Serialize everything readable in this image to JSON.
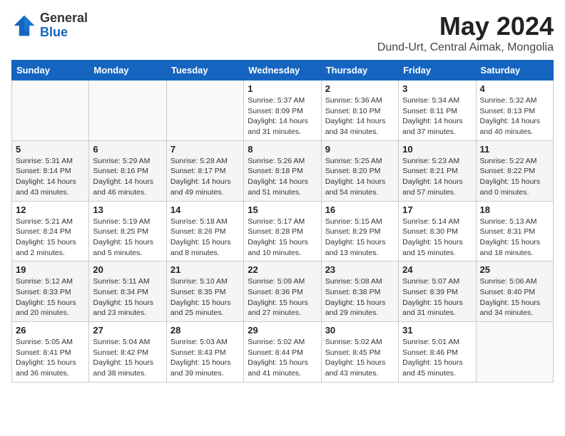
{
  "logo": {
    "general": "General",
    "blue": "Blue"
  },
  "title": "May 2024",
  "subtitle": "Dund-Urt, Central Aimak, Mongolia",
  "days_of_week": [
    "Sunday",
    "Monday",
    "Tuesday",
    "Wednesday",
    "Thursday",
    "Friday",
    "Saturday"
  ],
  "weeks": [
    [
      {
        "day": "",
        "info": ""
      },
      {
        "day": "",
        "info": ""
      },
      {
        "day": "",
        "info": ""
      },
      {
        "day": "1",
        "info": "Sunrise: 5:37 AM\nSunset: 8:09 PM\nDaylight: 14 hours\nand 31 minutes."
      },
      {
        "day": "2",
        "info": "Sunrise: 5:36 AM\nSunset: 8:10 PM\nDaylight: 14 hours\nand 34 minutes."
      },
      {
        "day": "3",
        "info": "Sunrise: 5:34 AM\nSunset: 8:11 PM\nDaylight: 14 hours\nand 37 minutes."
      },
      {
        "day": "4",
        "info": "Sunrise: 5:32 AM\nSunset: 8:13 PM\nDaylight: 14 hours\nand 40 minutes."
      }
    ],
    [
      {
        "day": "5",
        "info": "Sunrise: 5:31 AM\nSunset: 8:14 PM\nDaylight: 14 hours\nand 43 minutes."
      },
      {
        "day": "6",
        "info": "Sunrise: 5:29 AM\nSunset: 8:16 PM\nDaylight: 14 hours\nand 46 minutes."
      },
      {
        "day": "7",
        "info": "Sunrise: 5:28 AM\nSunset: 8:17 PM\nDaylight: 14 hours\nand 49 minutes."
      },
      {
        "day": "8",
        "info": "Sunrise: 5:26 AM\nSunset: 8:18 PM\nDaylight: 14 hours\nand 51 minutes."
      },
      {
        "day": "9",
        "info": "Sunrise: 5:25 AM\nSunset: 8:20 PM\nDaylight: 14 hours\nand 54 minutes."
      },
      {
        "day": "10",
        "info": "Sunrise: 5:23 AM\nSunset: 8:21 PM\nDaylight: 14 hours\nand 57 minutes."
      },
      {
        "day": "11",
        "info": "Sunrise: 5:22 AM\nSunset: 8:22 PM\nDaylight: 15 hours\nand 0 minutes."
      }
    ],
    [
      {
        "day": "12",
        "info": "Sunrise: 5:21 AM\nSunset: 8:24 PM\nDaylight: 15 hours\nand 2 minutes."
      },
      {
        "day": "13",
        "info": "Sunrise: 5:19 AM\nSunset: 8:25 PM\nDaylight: 15 hours\nand 5 minutes."
      },
      {
        "day": "14",
        "info": "Sunrise: 5:18 AM\nSunset: 8:26 PM\nDaylight: 15 hours\nand 8 minutes."
      },
      {
        "day": "15",
        "info": "Sunrise: 5:17 AM\nSunset: 8:28 PM\nDaylight: 15 hours\nand 10 minutes."
      },
      {
        "day": "16",
        "info": "Sunrise: 5:15 AM\nSunset: 8:29 PM\nDaylight: 15 hours\nand 13 minutes."
      },
      {
        "day": "17",
        "info": "Sunrise: 5:14 AM\nSunset: 8:30 PM\nDaylight: 15 hours\nand 15 minutes."
      },
      {
        "day": "18",
        "info": "Sunrise: 5:13 AM\nSunset: 8:31 PM\nDaylight: 15 hours\nand 18 minutes."
      }
    ],
    [
      {
        "day": "19",
        "info": "Sunrise: 5:12 AM\nSunset: 8:33 PM\nDaylight: 15 hours\nand 20 minutes."
      },
      {
        "day": "20",
        "info": "Sunrise: 5:11 AM\nSunset: 8:34 PM\nDaylight: 15 hours\nand 23 minutes."
      },
      {
        "day": "21",
        "info": "Sunrise: 5:10 AM\nSunset: 8:35 PM\nDaylight: 15 hours\nand 25 minutes."
      },
      {
        "day": "22",
        "info": "Sunrise: 5:09 AM\nSunset: 8:36 PM\nDaylight: 15 hours\nand 27 minutes."
      },
      {
        "day": "23",
        "info": "Sunrise: 5:08 AM\nSunset: 8:38 PM\nDaylight: 15 hours\nand 29 minutes."
      },
      {
        "day": "24",
        "info": "Sunrise: 5:07 AM\nSunset: 8:39 PM\nDaylight: 15 hours\nand 31 minutes."
      },
      {
        "day": "25",
        "info": "Sunrise: 5:06 AM\nSunset: 8:40 PM\nDaylight: 15 hours\nand 34 minutes."
      }
    ],
    [
      {
        "day": "26",
        "info": "Sunrise: 5:05 AM\nSunset: 8:41 PM\nDaylight: 15 hours\nand 36 minutes."
      },
      {
        "day": "27",
        "info": "Sunrise: 5:04 AM\nSunset: 8:42 PM\nDaylight: 15 hours\nand 38 minutes."
      },
      {
        "day": "28",
        "info": "Sunrise: 5:03 AM\nSunset: 8:43 PM\nDaylight: 15 hours\nand 39 minutes."
      },
      {
        "day": "29",
        "info": "Sunrise: 5:02 AM\nSunset: 8:44 PM\nDaylight: 15 hours\nand 41 minutes."
      },
      {
        "day": "30",
        "info": "Sunrise: 5:02 AM\nSunset: 8:45 PM\nDaylight: 15 hours\nand 43 minutes."
      },
      {
        "day": "31",
        "info": "Sunrise: 5:01 AM\nSunset: 8:46 PM\nDaylight: 15 hours\nand 45 minutes."
      },
      {
        "day": "",
        "info": ""
      }
    ]
  ]
}
